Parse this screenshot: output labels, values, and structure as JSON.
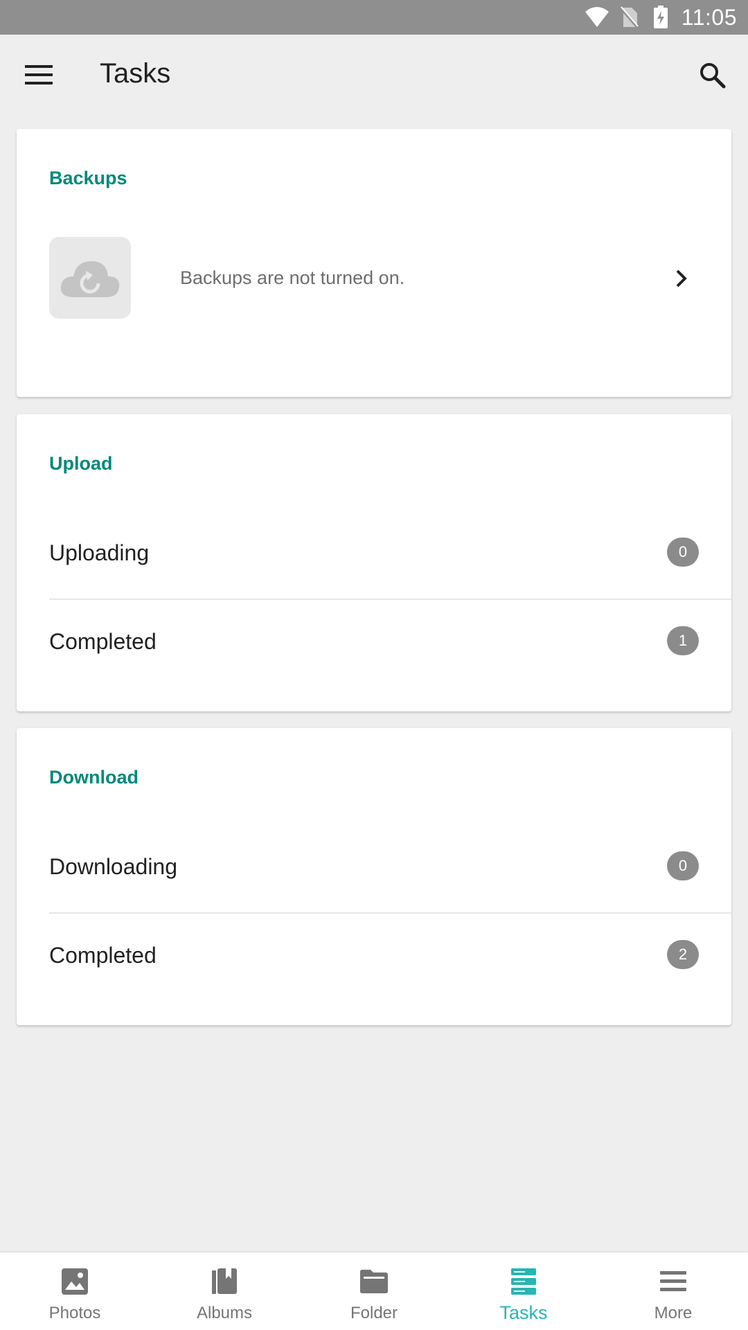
{
  "status_bar": {
    "time": "11:05",
    "icons": [
      "wifi-icon",
      "no-sim-icon",
      "battery-charging-icon"
    ]
  },
  "app_bar": {
    "title": "Tasks",
    "menu_icon": "hamburger-menu-icon",
    "search_icon": "search-icon"
  },
  "backups": {
    "title": "Backups",
    "message": "Backups are not turned on.",
    "thumb_icon": "cloud-backup-icon",
    "chevron_icon": "chevron-right-icon"
  },
  "upload": {
    "title": "Upload",
    "rows": [
      {
        "label": "Uploading",
        "count": "0"
      },
      {
        "label": "Completed",
        "count": "1"
      }
    ]
  },
  "download": {
    "title": "Download",
    "rows": [
      {
        "label": "Downloading",
        "count": "0"
      },
      {
        "label": "Completed",
        "count": "2"
      }
    ]
  },
  "bottom_nav": {
    "items": [
      {
        "label": "Photos",
        "icon": "photos-icon",
        "active": false
      },
      {
        "label": "Albums",
        "icon": "albums-icon",
        "active": false
      },
      {
        "label": "Folder",
        "icon": "folder-icon",
        "active": false
      },
      {
        "label": "Tasks",
        "icon": "tasks-icon",
        "active": true
      },
      {
        "label": "More",
        "icon": "more-menu-icon",
        "active": false
      }
    ]
  },
  "colors": {
    "accent": "#00897b",
    "active_tab": "#26b5b5",
    "badge": "#8b8b8b",
    "status_bar": "#8f8f8f",
    "background": "#eeeeee"
  }
}
